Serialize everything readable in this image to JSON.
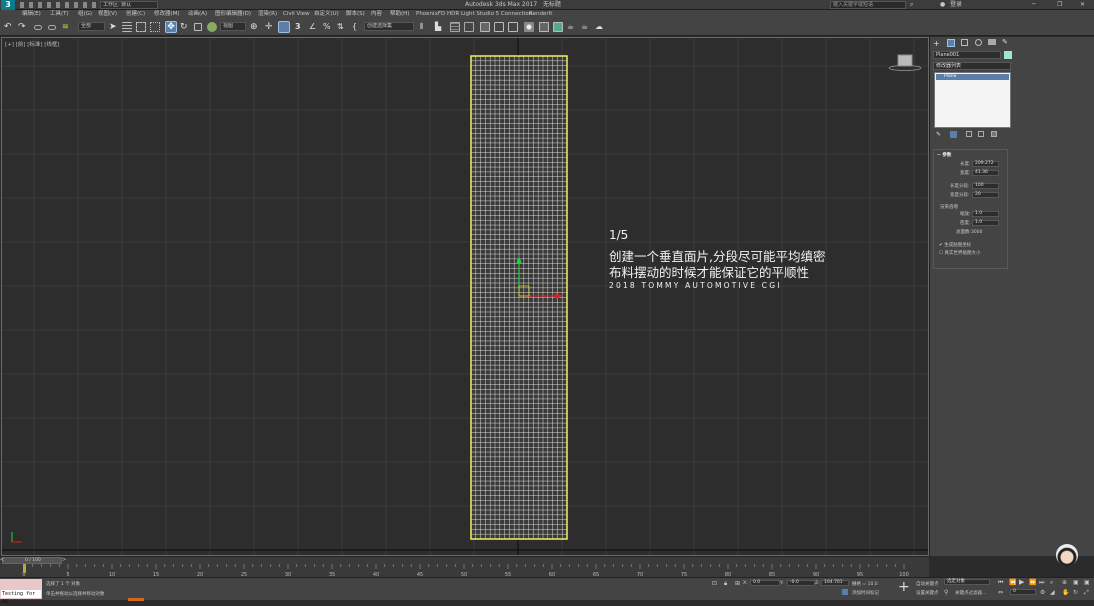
{
  "app": {
    "title": "Autodesk 3ds Max 2017",
    "file": "无标题",
    "workspace": "工作区: 默认",
    "search_placeholder": "键入关键字或短语",
    "login": "登录",
    "logo": "3"
  },
  "menu": [
    "编辑(E)",
    "工具(T)",
    "组(G)",
    "视图(V)",
    "创建(C)",
    "修改器(M)",
    "动画(A)",
    "图形编辑器(D)",
    "渲染(R)",
    "Civil View",
    "自定义(U)",
    "脚本(S)",
    "内容",
    "帮助(H)",
    "PhoenixFD",
    "HDR Light Studio 5 Connection",
    "RenderIt"
  ],
  "toolbar": {
    "filter_dropdown": "全部",
    "ref_coord": "视图",
    "selection_set": "创建选择集"
  },
  "viewport": {
    "label": "[+] [前] [标准] [线框]"
  },
  "annotation": {
    "step": "1/5",
    "line1": "创建一个垂直面片,分段尽可能平均缜密",
    "line2": "布料摆动的时候才能保证它的平顺性",
    "brand": "2018 TOMMY AUTOMOTIVE CGI"
  },
  "command_panel": {
    "object_name": "Plane001",
    "modifier_list": "修改器列表",
    "stack_item": "Plane",
    "rollout_title": "参数",
    "length_label": "长度:",
    "length_value": "209.272",
    "width_label": "宽度:",
    "width_value": "41.36",
    "length_segs_label": "长度分段:",
    "length_segs_value": "100",
    "width_segs_label": "宽度分段:",
    "width_segs_value": "20",
    "render_mult_title": "渲染倍增",
    "scale_label": "缩放:",
    "scale_value": "1.0",
    "density_label": "密度:",
    "density_value": "1.0",
    "total_faces_label": "总面数:",
    "total_faces_value": "3000",
    "gen_mapping": "生成贴图坐标",
    "real_world": "真实世界贴图大小"
  },
  "timeline": {
    "frame_indicator": "0 / 100",
    "ticks": [
      "0",
      "5",
      "10",
      "15",
      "20",
      "25",
      "30",
      "35",
      "40",
      "45",
      "50",
      "55",
      "60",
      "65",
      "70",
      "75",
      "80",
      "85",
      "90",
      "95",
      "100"
    ]
  },
  "status": {
    "script_text": "Testing for AG",
    "selected": "选择了 1 个 对象",
    "hint": "单击并拖动以选择并移动对象",
    "x_label": "X:",
    "x_value": "0.0",
    "y_label": "Y:",
    "y_value": "-0.0",
    "z_label": "Z:",
    "z_value": "104.701",
    "grid_label": "栅格 = 10.0",
    "add_time_tag": "添加时间标记",
    "auto_key": "自动关键点",
    "selected_obj": "选定对象",
    "set_key": "设置关键点",
    "key_filters": "关键点过滤器...",
    "frame_value": "0"
  },
  "colors": {
    "selection_yellow": "#f0f060",
    "mesh_white": "#e8e8e8",
    "active_blue": "#5b7fa8"
  }
}
